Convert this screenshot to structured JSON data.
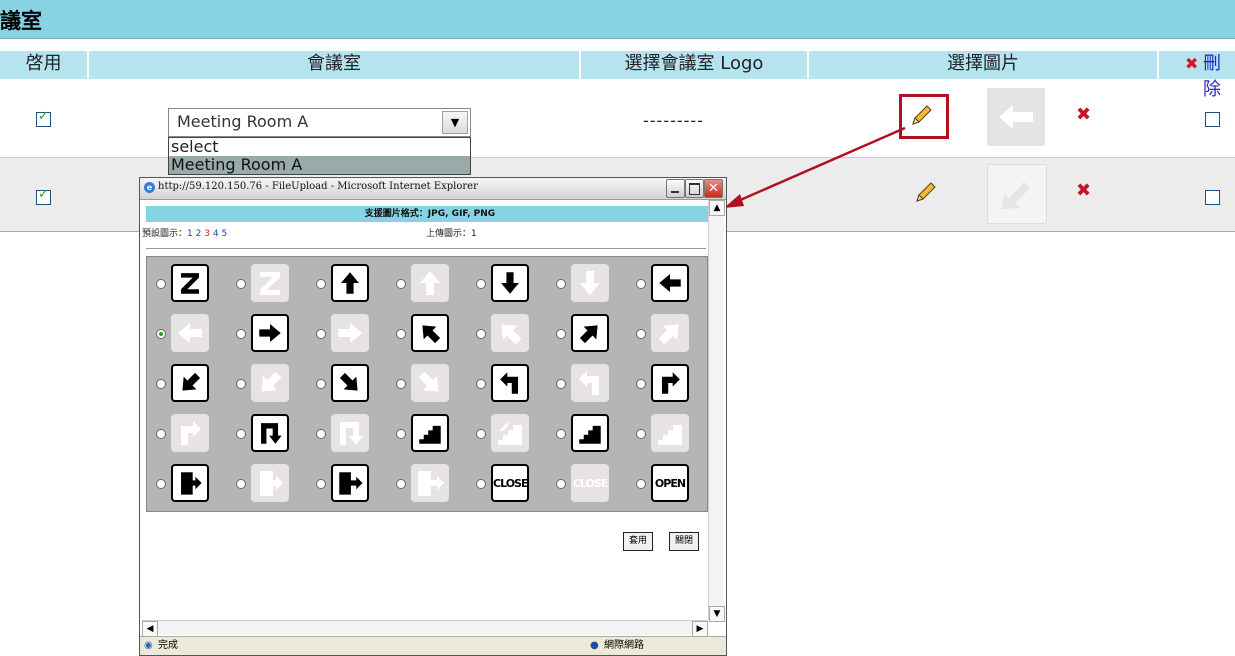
{
  "page": {
    "title": "議室",
    "headers": {
      "enable": "啓用",
      "room": "會議室",
      "logo": "選擇會議室 Logo",
      "image": "選擇圖片",
      "delete": "刪除"
    },
    "row1": {
      "room_value": "Meeting Room A",
      "logo_text": "---------"
    },
    "dropdown_options": [
      "select",
      "Meeting Room A"
    ]
  },
  "popup": {
    "title": "http://59.120.150.76 - FileUpload - Microsoft Internet Explorer",
    "format_label": "支援圖片格式：JPG, GIF, PNG",
    "builtin_label": "預設圖示：",
    "builtin_pages": [
      "1",
      "2",
      "3",
      "4",
      "5"
    ],
    "current_page": "3",
    "upload_label": "上傳圖示：1",
    "apply_button": "套用",
    "close_button": "關閉",
    "status_done": "完成",
    "status_zone": "網際網路",
    "icon_words": {
      "close": "CLOSE",
      "open": "OPEN"
    }
  }
}
